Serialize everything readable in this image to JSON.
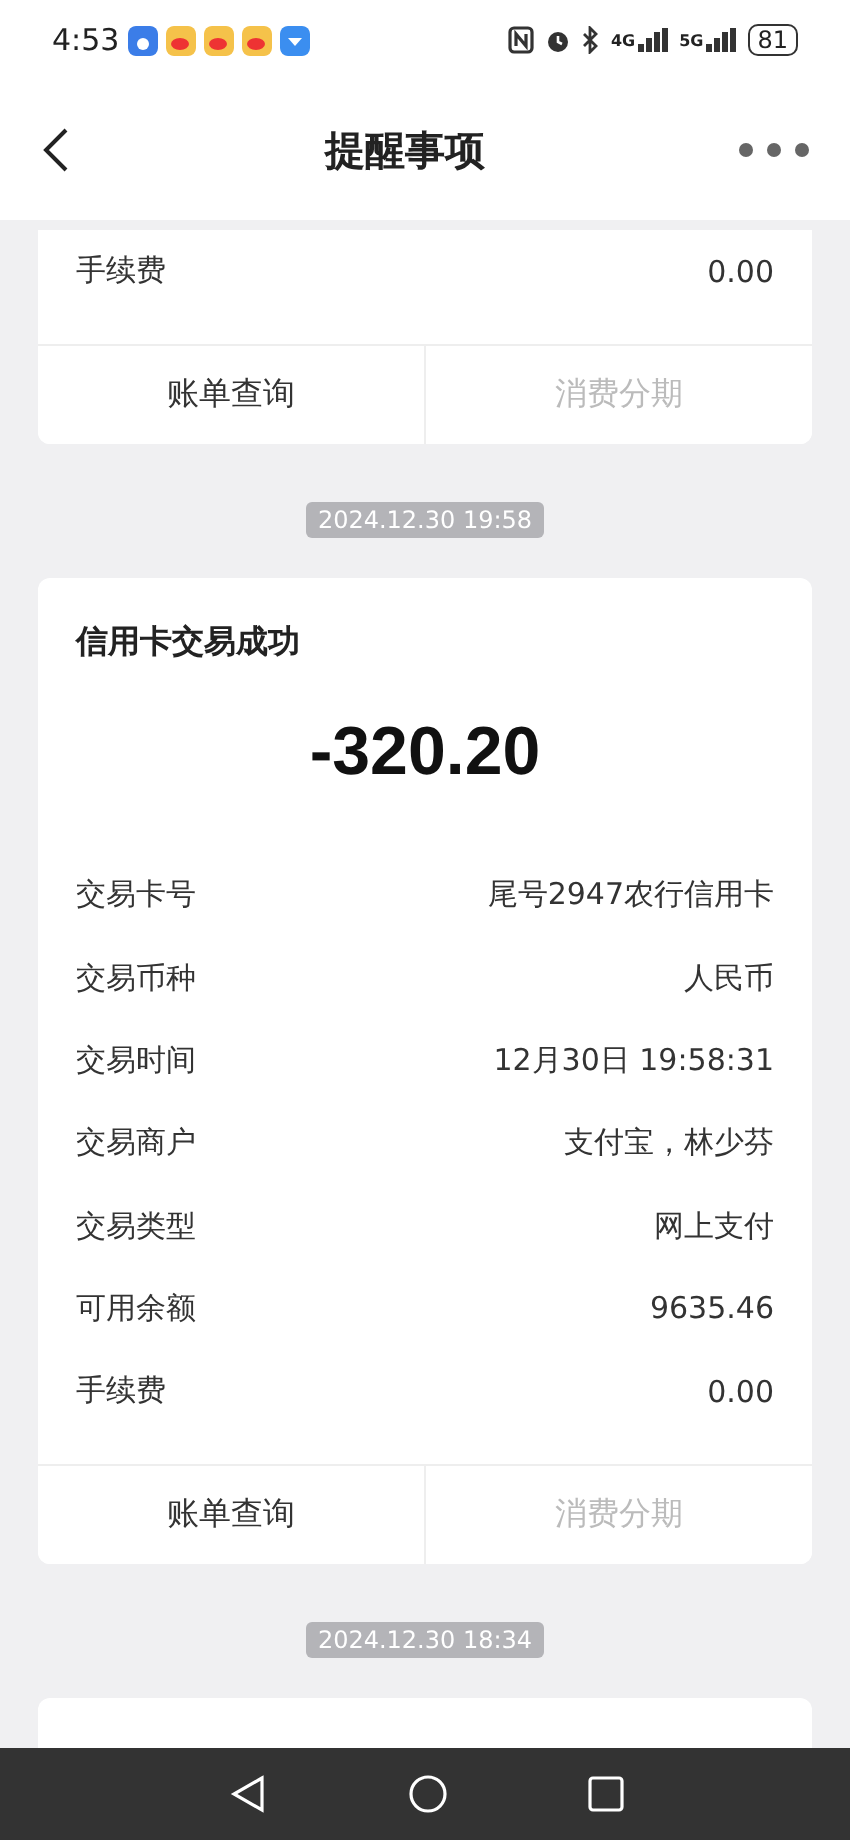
{
  "status_bar": {
    "time": "4:53",
    "network_4g": "4G",
    "network_5g": "5G",
    "battery": "81"
  },
  "header": {
    "title": "提醒事项"
  },
  "feed": [
    {
      "kind": "card",
      "rows": [
        {
          "label": "手续费",
          "value": "0.00"
        }
      ],
      "buttons": [
        {
          "label": "账单查询",
          "disabled": false
        },
        {
          "label": "消费分期",
          "disabled": true
        }
      ]
    },
    {
      "kind": "timestamp",
      "text": "2024.12.30 19:58"
    },
    {
      "kind": "card",
      "title": "信用卡交易成功",
      "amount": "-320.20",
      "rows": [
        {
          "label": "交易卡号",
          "value": "尾号2947农行信用卡"
        },
        {
          "label": "交易币种",
          "value": "人民币"
        },
        {
          "label": "交易时间",
          "value": "12月30日 19:58:31"
        },
        {
          "label": "交易商户",
          "value": "支付宝，林少芬"
        },
        {
          "label": "交易类型",
          "value": "网上支付"
        },
        {
          "label": "可用余额",
          "value": "9635.46"
        },
        {
          "label": "手续费",
          "value": "0.00"
        }
      ],
      "buttons": [
        {
          "label": "账单查询",
          "disabled": false
        },
        {
          "label": "消费分期",
          "disabled": true
        }
      ]
    },
    {
      "kind": "timestamp",
      "text": "2024.12.30 18:34"
    },
    {
      "kind": "card"
    }
  ]
}
